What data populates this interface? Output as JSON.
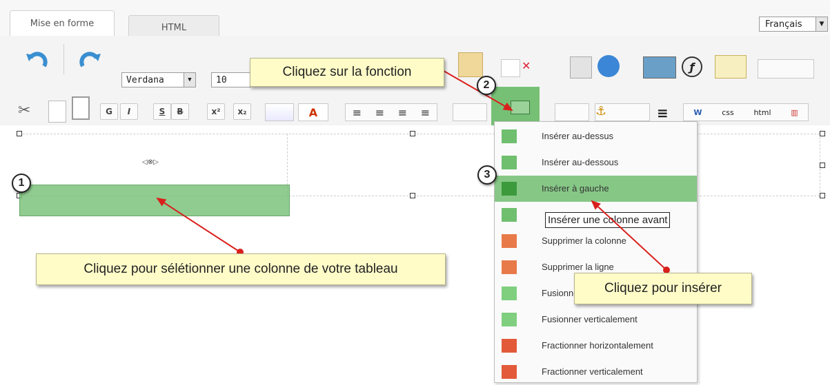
{
  "tabs": [
    {
      "label": "Mise en forme",
      "active": true
    },
    {
      "label": "HTML",
      "active": false
    }
  ],
  "language_select": {
    "value": "Français"
  },
  "toolbar": {
    "font_family": "Verdana",
    "font_size": "10",
    "format_buttons": [
      "G",
      "I",
      "S",
      "B",
      "x²",
      "x₂"
    ]
  },
  "menu": {
    "items": [
      {
        "label": "Insérer au-dessus",
        "icon": "insert-above-icon"
      },
      {
        "label": "Insérer au-dessous",
        "icon": "insert-below-icon"
      },
      {
        "label": "Insérer à gauche",
        "icon": "insert-left-icon",
        "highlighted": true
      },
      {
        "label": "Insérer une colonne avant",
        "icon": "insert-right-icon"
      },
      {
        "label": "Supprimer la colonne",
        "icon": "delete-column-icon"
      },
      {
        "label": "Supprimer la ligne",
        "icon": "delete-row-icon"
      },
      {
        "label": "Fusionner horizontalement",
        "icon": "merge-horizontal-icon"
      },
      {
        "label": "Fusionner verticalement",
        "icon": "merge-vertical-icon"
      },
      {
        "label": "Fractionner horizontalement",
        "icon": "split-horizontal-icon"
      },
      {
        "label": "Fractionner verticalement",
        "icon": "split-vertical-icon"
      }
    ]
  },
  "tooltip": "Insérer une colonne avant",
  "callouts": {
    "function": "Cliquez sur la fonction",
    "select_column": "Cliquez pour sélétionner une colonne de votre tableau",
    "insert": "Cliquez pour insérer"
  },
  "steps": [
    "1",
    "2",
    "3"
  ],
  "colors": {
    "highlight": "#5fb65f",
    "callout_bg": "#fffcc8",
    "arrow": "#d9201c"
  }
}
